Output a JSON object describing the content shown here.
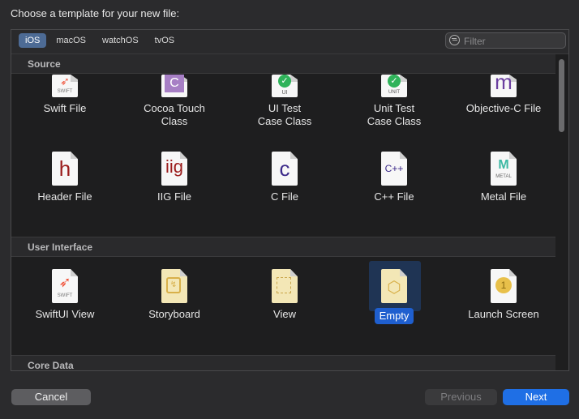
{
  "dialog": {
    "title": "Choose a template for your new file:"
  },
  "platforms": [
    {
      "label": "iOS",
      "selected": true
    },
    {
      "label": "macOS",
      "selected": false
    },
    {
      "label": "watchOS",
      "selected": false
    },
    {
      "label": "tvOS",
      "selected": false
    }
  ],
  "filter": {
    "placeholder": "Filter"
  },
  "sections": {
    "source": {
      "title": "Source",
      "items": [
        {
          "label": "Swift File",
          "icon": "swift-file-icon",
          "badge": "SWIFT"
        },
        {
          "label": "Cocoa Touch\nClass",
          "icon": "cocoa-touch-class-icon",
          "glyph": "C"
        },
        {
          "label": "UI Test\nCase Class",
          "icon": "ui-test-case-icon",
          "badge": "UI"
        },
        {
          "label": "Unit Test\nCase Class",
          "icon": "unit-test-case-icon",
          "badge": "UNIT"
        },
        {
          "label": "Objective-C File",
          "icon": "objective-c-file-icon",
          "glyph": "m"
        },
        {
          "label": "Header File",
          "icon": "header-file-icon",
          "glyph": "h"
        },
        {
          "label": "IIG File",
          "icon": "iig-file-icon",
          "glyph": "iig"
        },
        {
          "label": "C File",
          "icon": "c-file-icon",
          "glyph": "c"
        },
        {
          "label": "C++ File",
          "icon": "cpp-file-icon",
          "glyph": "C++"
        },
        {
          "label": "Metal File",
          "icon": "metal-file-icon",
          "badge": "METAL"
        }
      ]
    },
    "ui": {
      "title": "User Interface",
      "items": [
        {
          "label": "SwiftUI View",
          "icon": "swiftui-view-icon",
          "badge": "SWIFT"
        },
        {
          "label": "Storyboard",
          "icon": "storyboard-icon"
        },
        {
          "label": "View",
          "icon": "view-icon"
        },
        {
          "label": "Empty",
          "icon": "empty-icon",
          "selected": true
        },
        {
          "label": "Launch Screen",
          "icon": "launch-screen-icon",
          "glyph": "1"
        }
      ]
    },
    "coredata": {
      "title": "Core Data"
    }
  },
  "buttons": {
    "cancel": "Cancel",
    "previous": "Previous",
    "next": "Next"
  },
  "colors": {
    "accent": "#1f6fe5",
    "selection": "#1f5fcf",
    "swift": "#f05138",
    "purple": "#6b3fa0",
    "red": "#9b1c1c",
    "green": "#2fb35a"
  }
}
